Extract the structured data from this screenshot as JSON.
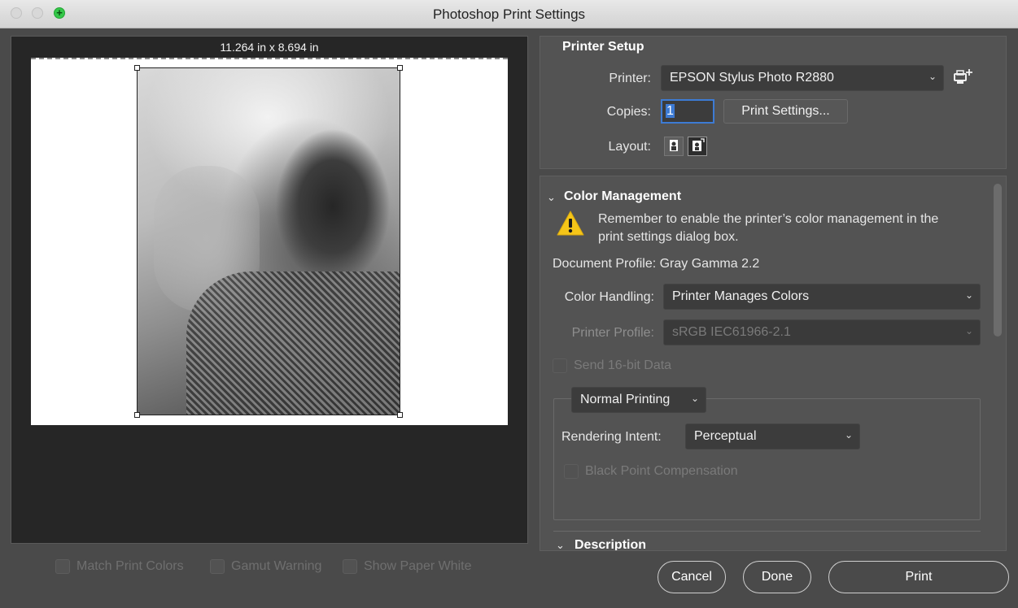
{
  "window": {
    "title": "Photoshop Print Settings"
  },
  "preview": {
    "paper_size": "11.264 in x 8.694 in"
  },
  "bottom_checks": [
    {
      "label": "Match Print Colors"
    },
    {
      "label": "Gamut Warning"
    },
    {
      "label": "Show Paper White"
    }
  ],
  "printer_setup": {
    "title": "Printer Setup",
    "printer_label": "Printer:",
    "printer_value": "EPSON Stylus Photo R2880",
    "copies_label": "Copies:",
    "copies_value": "1",
    "print_settings_button": "Print Settings...",
    "layout_label": "Layout:"
  },
  "color_management": {
    "title": "Color Management",
    "warning": "Remember to enable the printer’s color management in the print settings dialog box.",
    "document_profile": "Document Profile: Gray Gamma 2.2",
    "color_handling_label": "Color Handling:",
    "color_handling_value": "Printer Manages Colors",
    "printer_profile_label": "Printer Profile:",
    "printer_profile_value": "sRGB IEC61966-2.1",
    "send16_label": "Send 16-bit Data",
    "printing_mode": "Normal Printing",
    "rendering_intent_label": "Rendering Intent:",
    "rendering_intent_value": "Perceptual",
    "bpc_label": "Black Point Compensation"
  },
  "description": {
    "title": "Description"
  },
  "buttons": {
    "cancel": "Cancel",
    "done": "Done",
    "print": "Print"
  },
  "colors": {
    "accent": "#3d7bd4",
    "warning": "#f5c518",
    "zoom": "#35c84a"
  }
}
